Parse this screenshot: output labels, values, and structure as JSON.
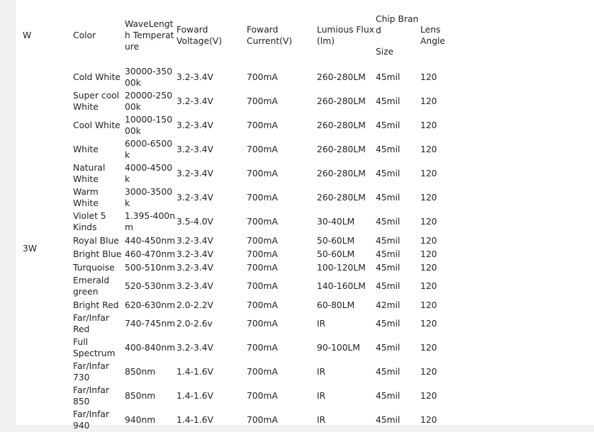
{
  "headers": {
    "w": "W",
    "color": "Color",
    "wavelength": "WaveLength Temperature",
    "voltage": "Foward Voltage(V)",
    "current": "Foward Current(V)",
    "flux": "Lumious Flux (lm)",
    "chip_brand": "Chip Brand",
    "chip_size": "Size",
    "lens": "Lens Angle"
  },
  "power": "3W",
  "rows": [
    {
      "color": "Cold White",
      "wave": "30000-35000k",
      "voltage": "3.2-3.4V",
      "current": "700mA",
      "flux": "260-280LM",
      "size": "45mil",
      "lens": "120"
    },
    {
      "color": "Super cool White",
      "wave": "20000-25000k",
      "voltage": "3.2-3.4V",
      "current": "700mA",
      "flux": "260-280LM",
      "size": "45mil",
      "lens": "120"
    },
    {
      "color": "Cool White",
      "wave": "10000-15000k",
      "voltage": "3.2-3.4V",
      "current": "700mA",
      "flux": "260-280LM",
      "size": "45mil",
      "lens": "120"
    },
    {
      "color": "White",
      "wave": "6000-6500k",
      "voltage": "3.2-3.4V",
      "current": "700mA",
      "flux": "260-280LM",
      "size": "45mil",
      "lens": "120"
    },
    {
      "color": "Natural White",
      "wave": "4000-4500k",
      "voltage": "3.2-3.4V",
      "current": "700mA",
      "flux": "260-280LM",
      "size": "45mil",
      "lens": "120"
    },
    {
      "color": "Warm White",
      "wave": "3000-3500k",
      "voltage": "3.2-3.4V",
      "current": "700mA",
      "flux": "260-280LM",
      "size": "45mil",
      "lens": "120"
    },
    {
      "color": "Violet 5 Kinds",
      "wave": "1.395-400nm",
      "voltage": "3.5-4.0V",
      "current": "700mA",
      "flux": "30-40LM",
      "size": "45mil",
      "lens": "120"
    },
    {
      "color": "Royal Blue",
      "wave": "440-450nm",
      "voltage": "3.2-3.4V",
      "current": "700mA",
      "flux": "50-60LM",
      "size": "45mil",
      "lens": "120"
    },
    {
      "color": "Bright Blue",
      "wave": "460-470nm",
      "voltage": "3.2-3.4V",
      "current": "700mA",
      "flux": "50-60LM",
      "size": "45mil",
      "lens": "120"
    },
    {
      "color": "Turquoise",
      "wave": "500-510nm",
      "voltage": "3.2-3.4V",
      "current": "700mA",
      "flux": "100-120LM",
      "size": "45mil",
      "lens": "120"
    },
    {
      "color": "Emerald green",
      "wave": "520-530nm",
      "voltage": "3.2-3.4V",
      "current": "700mA",
      "flux": "140-160LM",
      "size": "45mil",
      "lens": "120"
    },
    {
      "color": "Bright Red",
      "wave": "620-630nm",
      "voltage": "2.0-2.2V",
      "current": "700mA",
      "flux": "60-80LM",
      "size": "42mil",
      "lens": "120"
    },
    {
      "color": "Far/Infar Red",
      "wave": "740-745nm",
      "voltage": "2.0-2.6v",
      "current": "700mA",
      "flux": "IR",
      "size": "45mil",
      "lens": "120"
    },
    {
      "color": "Full Spectrum",
      "wave": "400-840nm",
      "voltage": "3.2-3.4V",
      "current": "700mA",
      "flux": "90-100LM",
      "size": "45mil",
      "lens": "120"
    },
    {
      "color": "Far/Infar 730",
      "wave": "850nm",
      "voltage": "1.4-1.6V",
      "current": "700mA",
      "flux": "IR",
      "size": "45mil",
      "lens": "120"
    },
    {
      "color": "Far/Infar 850",
      "wave": "850nm",
      "voltage": "1.4-1.6V",
      "current": "700mA",
      "flux": "IR",
      "size": "45mil",
      "lens": "120"
    },
    {
      "color": "Far/Infar 940",
      "wave": "940nm",
      "voltage": "1.4-1.6V",
      "current": "700mA",
      "flux": "IR",
      "size": "45mil",
      "lens": "120"
    }
  ]
}
